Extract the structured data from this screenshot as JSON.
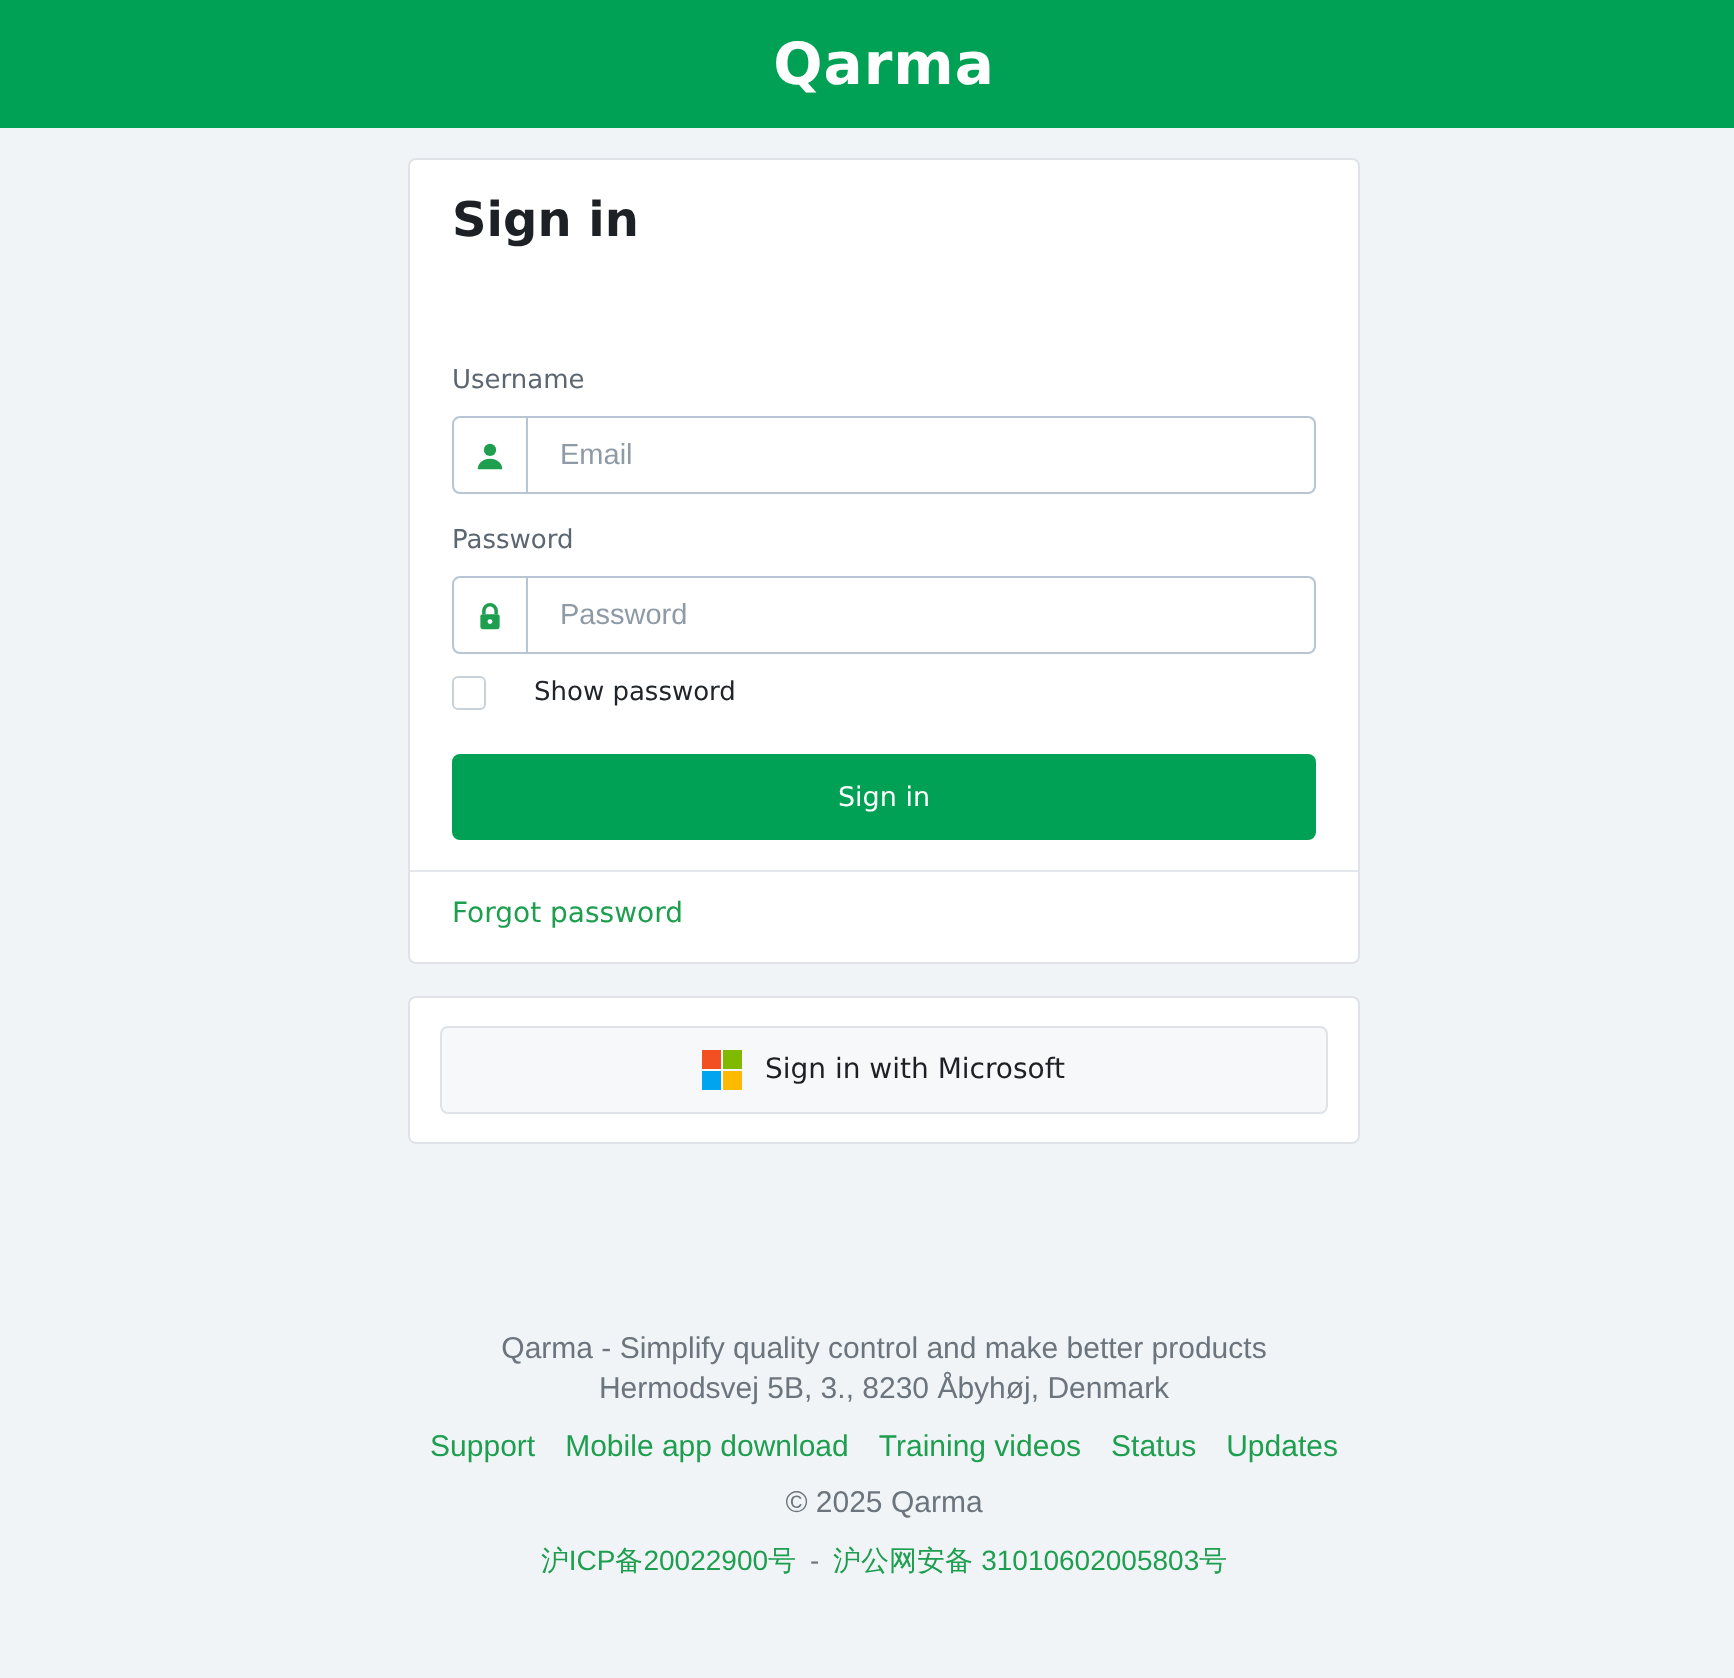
{
  "header": {
    "logo": "Qarma"
  },
  "login_card": {
    "title": "Sign in",
    "fields": [
      {
        "kind": "user",
        "label": "Username",
        "placeholder": "Email"
      },
      {
        "kind": "password",
        "label": "Password",
        "placeholder": "Password"
      }
    ],
    "show_password": {
      "label": "Show password",
      "checked": false
    },
    "submit_button": "Sign in",
    "forgot_link": "Forgot password"
  },
  "sso_card": {
    "button": "Sign in with Microsoft"
  },
  "footer": {
    "tagline": "Qarma - Simplify quality control and make better products",
    "address": "Hermodsvej 5B, 3., 8230 Åbyhøj, Denmark",
    "links": [
      "Support",
      "Mobile app download",
      "Training videos",
      "Status",
      "Updates"
    ],
    "copyright": "© 2025 Qarma",
    "registration_links": [
      "沪ICP备20022900号",
      "沪公网安备 31010602005803号"
    ],
    "separator": "-"
  }
}
